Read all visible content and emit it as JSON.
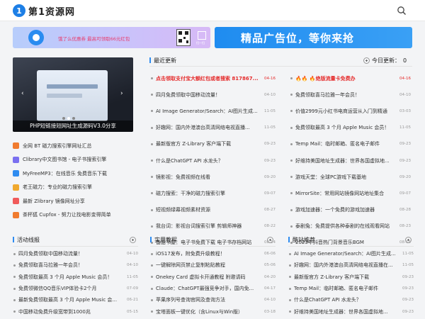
{
  "brand": {
    "badge": "1",
    "name": "第1资源网"
  },
  "ads": {
    "left_text": "饿了么优惠券 最高可领取66元红包",
    "left_scan_text": "扫一扫",
    "right_text": "精品广告位，等你来抢"
  },
  "banner": {
    "caption": "PHP短链接短网址生成源码V3.0分享",
    "prev": "‹",
    "next": "›"
  },
  "quick_links": [
    {
      "text": "全网 BT 磁力搜索引擎网址汇总",
      "color": "#f07b2f"
    },
    {
      "text": "Clibrary中文图书馆 - 电子书搜索引擎",
      "color": "#7a6ff0"
    },
    {
      "text": "MyFreeMP3：在线音乐 免费音乐下载",
      "color": "#2f8cf0"
    },
    {
      "text": "老王磁力：专业的磁力搜索引擎",
      "color": "#f0a92f"
    },
    {
      "text": "最新 Zlibrary 镜像网址分享",
      "color": "#f05a5a"
    },
    {
      "text": "茶杯狐 Cupfox - 努力让找电影变得简单",
      "color": "#f07b2f"
    }
  ],
  "latest": {
    "title": "最近更新",
    "today_label": "今日更新：",
    "today_count": "0",
    "left": [
      {
        "t": "点击领取支付宝大额红包或者搜索 817867...",
        "d": "04-16",
        "hot": true
      },
      {
        "t": "四月免费领取中国移动流量！",
        "d": "04-10"
      },
      {
        "t": "AI Image Generator/Search：AI图片生成...",
        "d": "11-05"
      },
      {
        "t": "好趣网：国内外港澳台高清网络电视直播...",
        "d": "11-05"
      },
      {
        "t": "最新版官方 Z-Library 客户端下载",
        "d": "09-23"
      },
      {
        "t": "什么是ChatGPT API 水龙头？",
        "d": "09-23"
      },
      {
        "t": "镜影视：免费视频在线看",
        "d": "09-20"
      },
      {
        "t": "磁力搜索：干净的磁力搜索引擎",
        "d": "09-07"
      },
      {
        "t": "短视频绿幕视频素材资源",
        "d": "08-27"
      },
      {
        "t": "我台词：影视台词搜索引擎 剪辑师神器",
        "d": "08-22"
      },
      {
        "t": "备胎书屋：电子书免费下载 电子书存档网站",
        "d": "08-14"
      }
    ],
    "right": [
      {
        "t": "🔥🔥 🔥绝版流量卡免费办",
        "d": "04-16",
        "hot": true
      },
      {
        "t": "免费领取喜马拉雅一年会员！",
        "d": "04-10"
      },
      {
        "t": "价值2999元小红书电商运营从入门到精通",
        "d": "03-03"
      },
      {
        "t": "免费领取最高 3 个月 Apple Music 会员！",
        "d": "11-05"
      },
      {
        "t": "Temp Mail：临时邮箱、匿名电子邮件",
        "d": "09-23"
      },
      {
        "t": "好维持美国地址生成器：世界各国虚拟地...",
        "d": "09-23"
      },
      {
        "t": "游戏天堂：全球PC游戏下载基地",
        "d": "09-20"
      },
      {
        "t": "MirrorSite：常用网站镜像网站地址集合",
        "d": "09-07"
      },
      {
        "t": "游戏加速器：一个免费的游戏加速器",
        "d": "08-28"
      },
      {
        "t": "泰剧兔：免费提供各种泰剧的在线观看网站",
        "d": "08-23"
      },
      {
        "t": "2023年抖音热门背景音乐BGM",
        "d": "08-14"
      }
    ]
  },
  "sections": [
    {
      "title": "活动线报",
      "accent": "#2f8cf0",
      "items": [
        {
          "t": "四月免费领取中国移动流量！",
          "d": "04-10"
        },
        {
          "t": "免费领取喜马拉雅一年会员！",
          "d": "04-10"
        },
        {
          "t": "免费领取最高 3 个月 Apple Music 会员！",
          "d": "11-05"
        },
        {
          "t": "免费领微信QQ音乐VIP体验卡2个月",
          "d": "07-09"
        },
        {
          "t": "最新免费领取最高 3 个月 Apple Music 会...",
          "d": "06-21"
        },
        {
          "t": "中国移动免费升级宽带到1000兆",
          "d": "05-15"
        }
      ]
    },
    {
      "title": "实用教程",
      "accent": "#2f8cf0",
      "items": [
        {
          "t": "iOS17发布，附免费升级教程！",
          "d": "06-06"
        },
        {
          "t": "一键解除网页禁止复制粘贴教程",
          "d": "05-06"
        },
        {
          "t": "Onekey Card 虚拟卡开通教程 附邀请码",
          "d": "04-20"
        },
        {
          "t": "Claude：ChatGPT最强竞争对手，国内免...",
          "d": "04-17"
        },
        {
          "t": "苹果序列号查询官网及查询方法",
          "d": "04-10"
        },
        {
          "t": "宝塔面板一键优化（含Linux与Win版）",
          "d": "03-18"
        }
      ]
    },
    {
      "title": "酷站推荐",
      "accent": "#2f8cf0",
      "items": [
        {
          "t": "AI Image Generator/Search：AI图片生成...",
          "d": "11-05"
        },
        {
          "t": "好趣网：国内外港澳台高清网络电视直播在...",
          "d": "11-05"
        },
        {
          "t": "最新版官方 Z-Library 客户端下载",
          "d": "09-23"
        },
        {
          "t": "Temp Mail：临时邮箱、匿名电子邮件",
          "d": "09-23"
        },
        {
          "t": "什么是ChatGPT API 水龙头？",
          "d": "09-23"
        },
        {
          "t": "好维持美国地址生成器：世界各国虚拟地...",
          "d": "09-23"
        }
      ]
    }
  ]
}
